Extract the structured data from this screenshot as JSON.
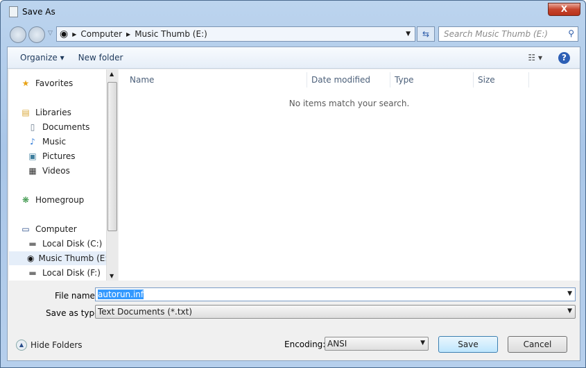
{
  "window": {
    "title": "Save As",
    "close_label": "X"
  },
  "address": {
    "crumbs": [
      "Computer",
      "Music Thumb (E:)"
    ]
  },
  "search": {
    "placeholder": "Search Music Thumb (E:)"
  },
  "toolbar": {
    "organize": "Organize ▾",
    "new_folder": "New folder",
    "views": "☷ ▾",
    "help": "?"
  },
  "nav": {
    "items": [
      {
        "label": "Favorites",
        "icon": "star-icon",
        "glyph": "★",
        "color": "#e8a317"
      },
      {
        "label": "Libraries",
        "icon": "library-icon",
        "glyph": "▤",
        "color": "#d9a83a"
      },
      {
        "label": "Documents",
        "icon": "documents-icon",
        "glyph": "▯",
        "color": "#6a7b8e"
      },
      {
        "label": "Music",
        "icon": "music-icon",
        "glyph": "♪",
        "color": "#2f7ad8"
      },
      {
        "label": "Pictures",
        "icon": "pictures-icon",
        "glyph": "▣",
        "color": "#3f7f9e"
      },
      {
        "label": "Videos",
        "icon": "videos-icon",
        "glyph": "▦",
        "color": "#333"
      },
      {
        "label": "Homegroup",
        "icon": "homegroup-icon",
        "glyph": "❋",
        "color": "#2d8f3d"
      },
      {
        "label": "Computer",
        "icon": "computer-icon",
        "glyph": "▭",
        "color": "#2a4d8a"
      },
      {
        "label": "Local Disk (C:)",
        "icon": "disk-icon",
        "glyph": "▬",
        "color": "#777"
      },
      {
        "label": "Music Thumb (E:)",
        "icon": "usb-drive-icon",
        "glyph": "◉",
        "color": "#111"
      },
      {
        "label": "Local Disk (F:)",
        "icon": "disk-icon",
        "glyph": "▬",
        "color": "#777"
      }
    ]
  },
  "list": {
    "columns": [
      "Name",
      "Date modified",
      "Type",
      "Size"
    ],
    "empty_message": "No items match your search."
  },
  "form": {
    "file_name_label": "File name:",
    "file_name_value": "autorun.inf",
    "type_label": "Save as type:",
    "type_value": "Text Documents (*.txt)",
    "encoding_label": "Encoding:",
    "encoding_value": "ANSI"
  },
  "buttons": {
    "hide_folders": "Hide Folders",
    "save": "Save",
    "cancel": "Cancel"
  }
}
